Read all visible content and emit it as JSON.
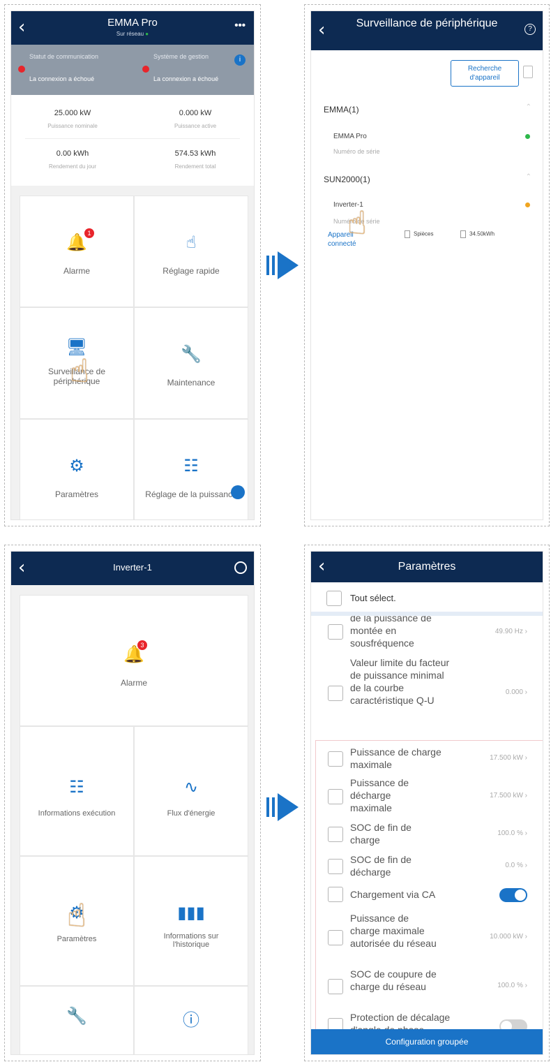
{
  "colors": {
    "header": "#0d2a52",
    "accent": "#1a73c7",
    "alarm_badge": "#e8252b",
    "online": "#2db84b",
    "warning": "#f0a520"
  },
  "panel1": {
    "title": "EMMA Pro",
    "subtitle": "Sur réseau",
    "menu": "•••",
    "status_left": {
      "label": "Statut de communication",
      "value": "La connexion a échoué"
    },
    "status_right": {
      "label": "Système de gestion",
      "value": "La connexion a échoué"
    },
    "info_badge": "i",
    "stats": [
      {
        "value": "25.000 kW",
        "label": "Puissance nominale"
      },
      {
        "value": "0.000 kW",
        "label": "Puissance active"
      },
      {
        "value": "0.00 kWh",
        "label": "Rendement du jour"
      },
      {
        "value": "574.53 kWh",
        "label": "Rendement total"
      }
    ],
    "menu_items": [
      {
        "label": "Alarme",
        "icon": "bell-icon",
        "badge": "1"
      },
      {
        "label": "Réglage rapide",
        "icon": "touch-icon"
      },
      {
        "label": "Surveillance de périphérique",
        "icon": "monitor-icon"
      },
      {
        "label": "Maintenance",
        "icon": "wrench-icon"
      },
      {
        "label": "Paramètres",
        "icon": "gear-icon"
      },
      {
        "label": "Réglage de la puissance",
        "icon": "sliders-icon"
      }
    ]
  },
  "panel2": {
    "title": "Surveillance de périphérique",
    "help": "?",
    "search_button": "Recherche d'appareil",
    "groups": [
      {
        "name": "EMMA(1)",
        "device": "EMMA Pro",
        "serial": "Numéro de série",
        "status": "online"
      },
      {
        "name": "SUN2000(1)",
        "device": "Inverter-1",
        "serial": "Numéro de série",
        "status": "warning",
        "connection": "Appareil connecté",
        "packs": "Spièces",
        "energy": "34.50kWh"
      }
    ]
  },
  "panel3": {
    "title": "Inverter-1",
    "menu_items": [
      {
        "label": "Alarme",
        "icon": "bell-icon",
        "badge": "3"
      },
      {
        "label": "Informations exécution",
        "icon": "sliders-icon"
      },
      {
        "label": "Flux d'énergie",
        "icon": "waveform-icon"
      },
      {
        "label": "Paramètres",
        "icon": "gear-icon"
      },
      {
        "label": "Informations sur l'historique",
        "icon": "bar-chart-icon"
      },
      {
        "label": "",
        "icon": "wrench-icon"
      },
      {
        "label": "",
        "icon": "info-icon"
      }
    ]
  },
  "panel4": {
    "title": "Paramètres",
    "select_all": "Tout sélect.",
    "params": [
      {
        "label": "de la puissance de montée en sousfréquence",
        "value": "49.90 Hz"
      },
      {
        "label": "Valeur limite du facteur de puissance minimal de la courbe caractéristique Q-U",
        "value": "0.000"
      },
      {
        "label": "Puissance de charge maximale",
        "value": "17.500 kW"
      },
      {
        "label": "Puissance de décharge maximale",
        "value": "17.500 kW"
      },
      {
        "label": "SOC de fin de charge",
        "value": "100.0 %"
      },
      {
        "label": "SOC de fin de décharge",
        "value": "0.0 %"
      },
      {
        "label": "Chargement via CA",
        "toggle": true
      },
      {
        "label": "Puissance de charge maximale autorisée du réseau",
        "value": "10.000 kW"
      },
      {
        "label": "SOC de coupure de charge du réseau",
        "value": "100.0 %"
      },
      {
        "label": "Protection de décalage d'angle de phase",
        "toggle": false
      }
    ],
    "footer_button": "Configuration groupée"
  }
}
